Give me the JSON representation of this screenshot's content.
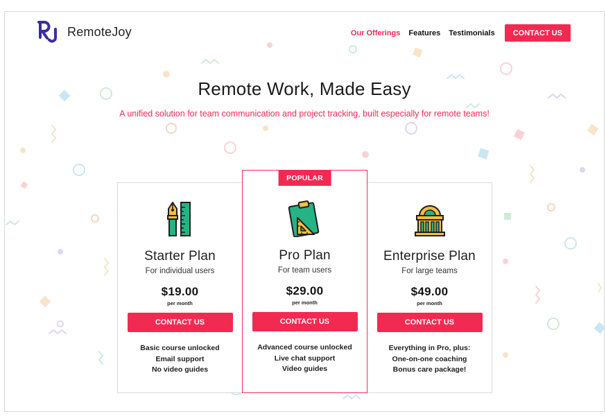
{
  "app": {
    "logo_text": "RemoteJoy",
    "brand_color": "#f22a52",
    "logo_color": "#3a2d9e"
  },
  "nav": {
    "items": [
      {
        "label": "Our Offerings",
        "active": true
      },
      {
        "label": "Features",
        "active": false
      },
      {
        "label": "Testimonials",
        "active": false
      }
    ],
    "cta_label": "CONTACT US"
  },
  "hero": {
    "title": "Remote Work, Made Easy",
    "subtitle": "A unified solution for team communication and project tracking, built especially for remote teams!"
  },
  "plans": [
    {
      "icon": "pen-ruler-icon",
      "name": "Starter Plan",
      "audience": "For individual users",
      "price": "$19.00",
      "period": "per month",
      "cta_label": "CONTACT US",
      "features": [
        "Basic course unlocked",
        "Email support",
        "No video guides"
      ]
    },
    {
      "icon": "clipboard-ruler-icon",
      "badge": "POPULAR",
      "name": "Pro Plan",
      "audience": "For team users",
      "price": "$29.00",
      "period": "per month",
      "cta_label": "CONTACT US",
      "features": [
        "Advanced course unlocked",
        "Live chat support",
        "Video guides"
      ]
    },
    {
      "icon": "building-icon",
      "name": "Enterprise Plan",
      "audience": "For large teams",
      "price": "$49.00",
      "period": "per month",
      "cta_label": "CONTACT US",
      "features": [
        "Everything in Pro, plus:",
        "One-on-one coaching",
        "Bonus care package!"
      ]
    }
  ]
}
